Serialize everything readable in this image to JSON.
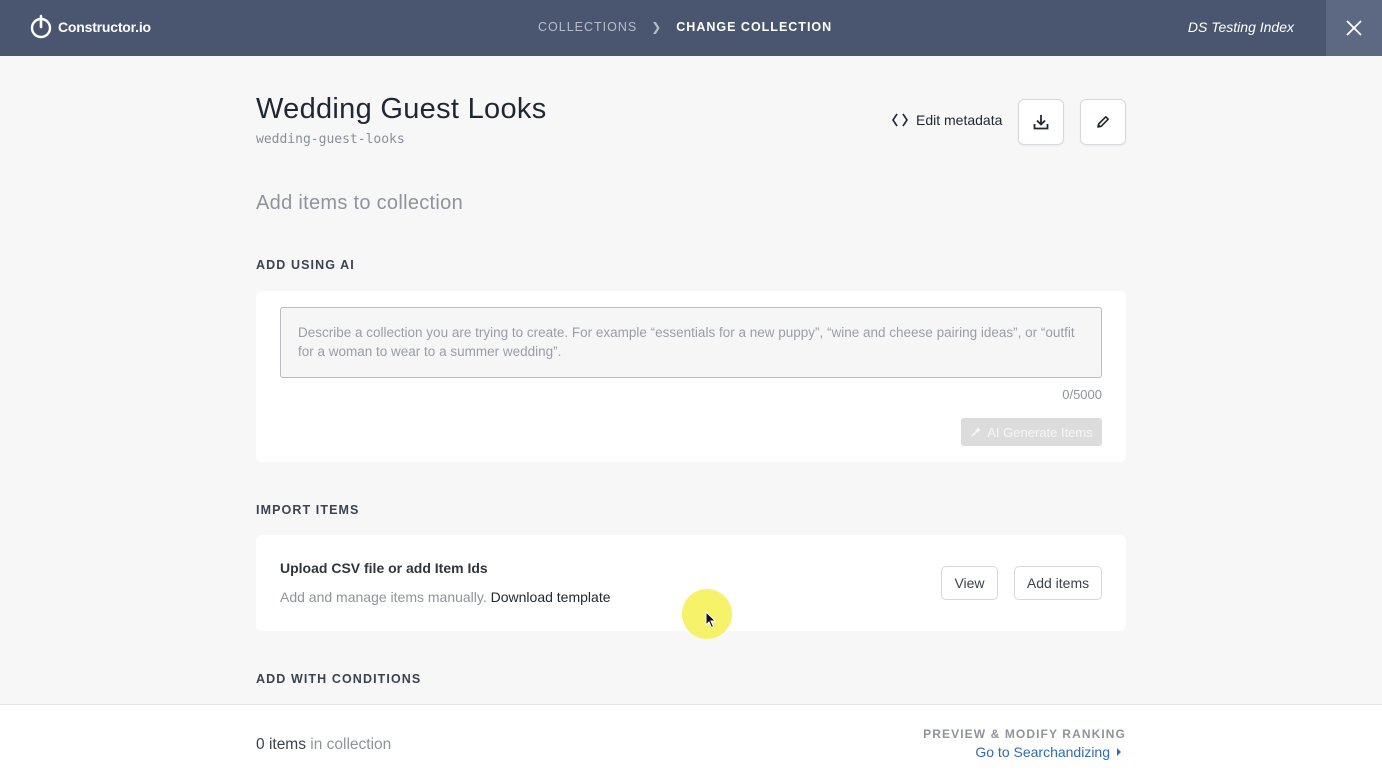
{
  "topbar": {
    "logo_text": "Constructor.io",
    "breadcrumb": [
      "COLLECTIONS",
      "CHANGE COLLECTION"
    ],
    "index_name": "DS Testing Index",
    "colors": {
      "background": "#4a5670",
      "close_bg": "#5d6982"
    }
  },
  "header": {
    "title": "Wedding Guest Looks",
    "slug": "wedding-guest-looks",
    "edit_metadata_label": "Edit metadata",
    "download_icon": "download-icon",
    "edit_icon": "pencil-icon"
  },
  "main": {
    "section_heading": "Add items to collection",
    "ai": {
      "label": "ADD USING AI",
      "placeholder": "Describe a collection you are trying to create. For example “essentials for a new puppy”, “wine and cheese pairing ideas”, or “outfit for a woman to wear to a summer wedding”.",
      "char_count": "0/5000",
      "generate_label": "AI Generate Items"
    },
    "import": {
      "label": "IMPORT ITEMS",
      "title": "Upload CSV file or add Item Ids",
      "description": "Add and manage items manually.",
      "download_template_link": "Download template",
      "view_label": "View",
      "add_items_label": "Add items"
    },
    "conditions_label": "ADD WITH CONDITIONS"
  },
  "footer": {
    "count": "0",
    "items_word": "items",
    "suffix": "in collection",
    "preview_label": "PREVIEW & MODIFY RANKING",
    "link_label": "Go to Searchandizing",
    "link_color": "#2f6db0"
  }
}
